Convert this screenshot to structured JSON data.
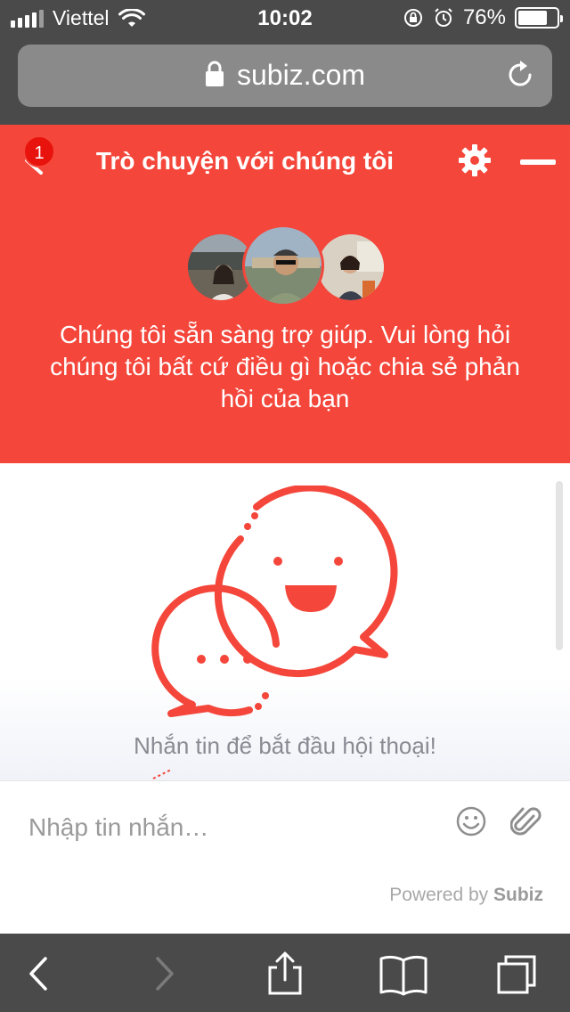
{
  "status_bar": {
    "carrier": "Viettel",
    "time": "10:02",
    "battery_text": "76%",
    "battery_level": 0.76
  },
  "browser": {
    "url": "subiz.com",
    "icons": [
      "lock-icon",
      "reload-icon"
    ]
  },
  "chat": {
    "title": "Trò chuyện với chúng tôi",
    "unread_count": "1",
    "intro": "Chúng tôi sẵn sàng trợ giúp. Vui lòng hỏi chúng tôi bất cứ điều gì hoặc chia sẻ phản hồi của bạn",
    "start_prompt": "Nhắn tin để bắt đầu hội thoại!",
    "accent_color": "#f4463a"
  },
  "composer": {
    "placeholder": "Nhập tin nhắn…",
    "powered_prefix": "Powered by",
    "powered_brand": "Subiz"
  },
  "toolbar": {
    "icons": [
      "back-icon",
      "forward-icon",
      "share-icon",
      "bookmarks-icon",
      "tabs-icon"
    ]
  }
}
